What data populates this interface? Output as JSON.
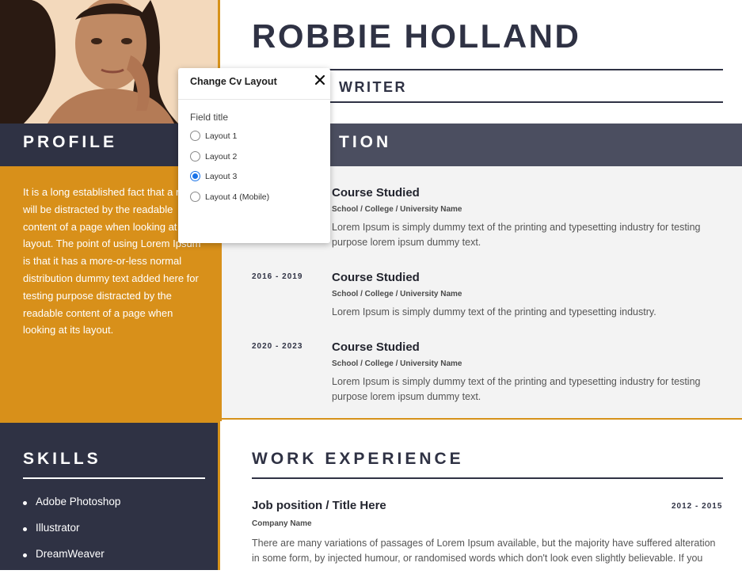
{
  "resume": {
    "name": "ROBBIE HOLLAND",
    "title_visible": "WRITER",
    "profile": {
      "heading": "PROFILE",
      "text": "It is a long established fact that a reader will be distracted by the readable content of a page when looking at its layout. The point of using Lorem Ipsum is that it has a more-or-less normal distribution dummy text added here for testing purpose distracted by the readable content of a page when looking at its layout."
    },
    "education": {
      "heading_visible": "TION",
      "items": [
        {
          "year": "",
          "course": "Course Studied",
          "school": "School / College / University Name",
          "desc": "Lorem Ipsum is simply dummy text of the printing and typesetting industry for testing purpose lorem ipsum dummy text."
        },
        {
          "year": "2016 - 2019",
          "course": "Course Studied",
          "school": "School / College / University Name",
          "desc": "Lorem Ipsum is simply dummy text of the printing and typesetting industry."
        },
        {
          "year": "2020 - 2023",
          "course": "Course Studied",
          "school": "School / College / University Name",
          "desc": "Lorem Ipsum is simply dummy text of the printing and typesetting industry for testing purpose lorem ipsum dummy text."
        }
      ]
    },
    "skills": {
      "heading": "SKILLS",
      "items": [
        "Adobe Photoshop",
        "Illustrator",
        "DreamWeaver"
      ]
    },
    "work": {
      "heading": "WORK EXPERIENCE",
      "position": "Job position / Title Here",
      "years": "2012 - 2015",
      "company": "Company Name",
      "desc": "There are many variations of passages of Lorem Ipsum available, but the majority have suffered alteration in some form, by injected humour, or randomised words which don't look even slightly believable. If you"
    }
  },
  "modal": {
    "title": "Change Cv Layout",
    "field_title": "Field title",
    "options": [
      {
        "label": "Layout 1",
        "checked": false
      },
      {
        "label": "Layout 2",
        "checked": false
      },
      {
        "label": "Layout 3",
        "checked": true
      },
      {
        "label": "Layout 4 (Mobile)",
        "checked": false
      }
    ],
    "close_icon": "close-icon"
  },
  "colors": {
    "navy": "#2f3244",
    "gold": "#d8901a",
    "header_gray": "#4b4e60",
    "accent_blue": "#1a73e8"
  }
}
